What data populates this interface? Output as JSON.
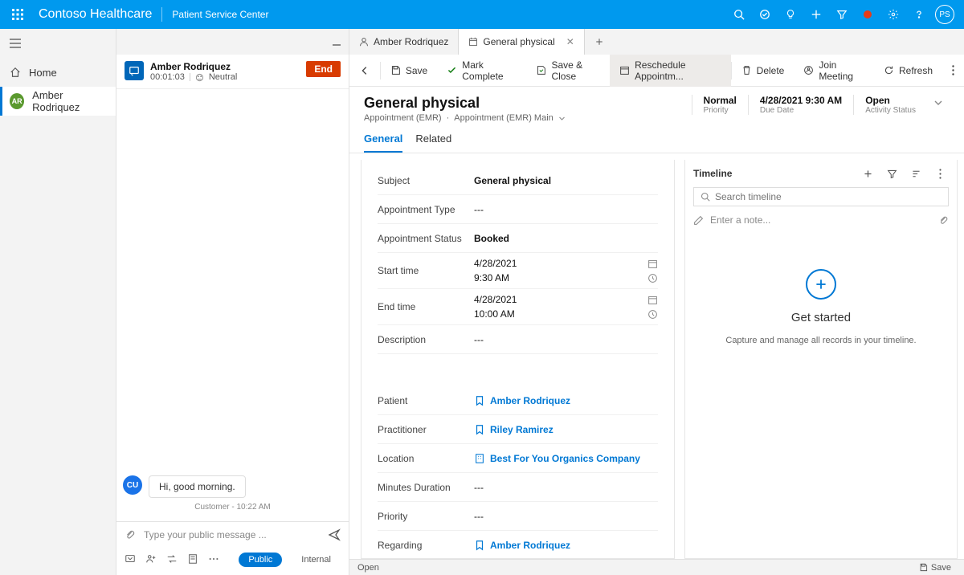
{
  "topbar": {
    "brand": "Contoso Healthcare",
    "subtitle": "Patient Service Center",
    "user_initials": "PS"
  },
  "leftnav": {
    "home": "Home",
    "active_item": {
      "initials": "AR",
      "label": "Amber Rodriquez"
    }
  },
  "chat": {
    "contact_name": "Amber Rodriquez",
    "timer": "00:01:03",
    "sentiment": "Neutral",
    "end_label": "End",
    "message": {
      "avatar": "CU",
      "text": "Hi, good morning.",
      "meta": "Customer - 10:22 AM"
    },
    "input_placeholder": "Type your public message ...",
    "footer": {
      "public": "Public",
      "internal": "Internal"
    }
  },
  "tabs": {
    "t0": "Amber Rodriquez",
    "t1": "General physical"
  },
  "cmd": {
    "save": "Save",
    "mark_complete": "Mark Complete",
    "save_close": "Save & Close",
    "reschedule": "Reschedule Appointm...",
    "delete": "Delete",
    "join": "Join Meeting",
    "refresh": "Refresh"
  },
  "record": {
    "title": "General physical",
    "sub1": "Appointment (EMR)",
    "sub2": "Appointment (EMR) Main",
    "stats": {
      "priority_v": "Normal",
      "priority_l": "Priority",
      "due_v": "4/28/2021 9:30 AM",
      "due_l": "Due Date",
      "status_v": "Open",
      "status_l": "Activity Status"
    },
    "tab_general": "General",
    "tab_related": "Related"
  },
  "form": {
    "subject_lbl": "Subject",
    "subject_val": "General physical",
    "appt_type_lbl": "Appointment Type",
    "appt_type_val": "---",
    "appt_status_lbl": "Appointment Status",
    "appt_status_val": "Booked",
    "start_lbl": "Start time",
    "start_date": "4/28/2021",
    "start_time": "9:30 AM",
    "end_lbl": "End time",
    "end_date": "4/28/2021",
    "end_time": "10:00 AM",
    "desc_lbl": "Description",
    "desc_val": "---",
    "patient_lbl": "Patient",
    "patient_val": "Amber Rodriquez",
    "pract_lbl": "Practitioner",
    "pract_val": "Riley Ramirez",
    "loc_lbl": "Location",
    "loc_val": "Best For You Organics Company",
    "dur_lbl": "Minutes Duration",
    "dur_val": "---",
    "prio_lbl": "Priority",
    "prio_val": "---",
    "reg_lbl": "Regarding",
    "reg_val": "Amber Rodriquez"
  },
  "timeline": {
    "title": "Timeline",
    "search_placeholder": "Search timeline",
    "note_placeholder": "Enter a note...",
    "empty_title": "Get started",
    "empty_sub": "Capture and manage all records in your timeline."
  },
  "statusbar": {
    "status": "Open",
    "save": "Save"
  }
}
